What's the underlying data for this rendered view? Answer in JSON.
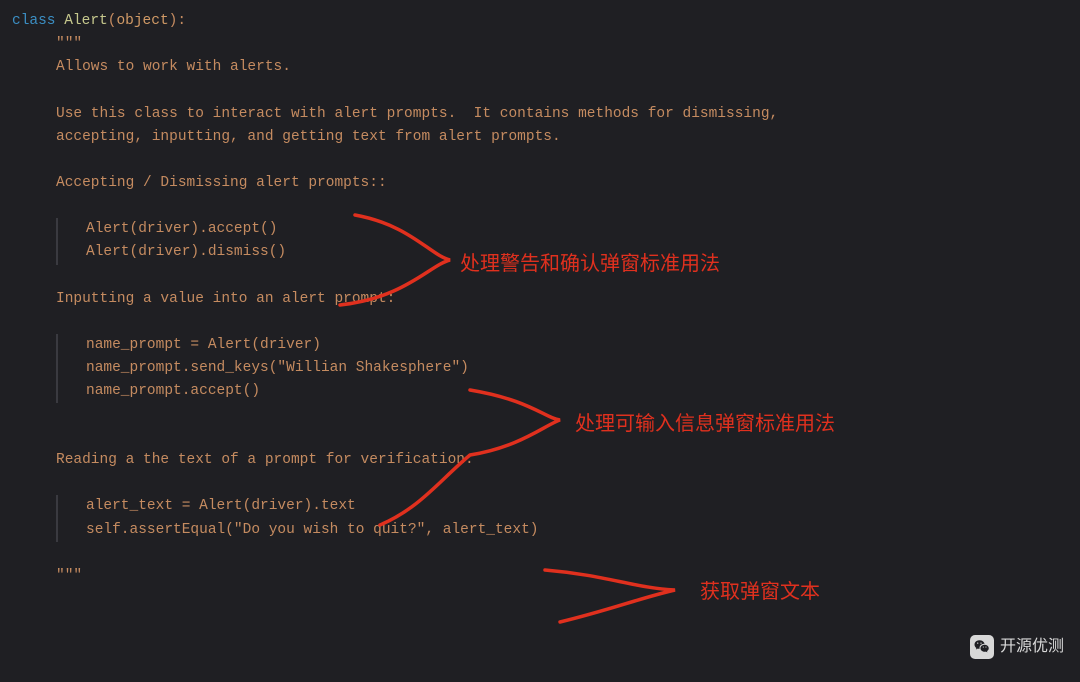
{
  "code": {
    "kw_class": "class",
    "classname": "Alert",
    "arg": "object",
    "triple_quote": "\"\"\"",
    "doc1": "Allows to work with alerts.",
    "doc2": "Use this class to interact with alert prompts.  It contains methods for dismissing,",
    "doc3": "accepting, inputting, and getting text from alert prompts.",
    "sec1_title": "Accepting / Dismissing alert prompts::",
    "sec1_line1": "Alert(driver).accept()",
    "sec1_line2": "Alert(driver).dismiss()",
    "sec2_title": "Inputting a value into an alert prompt:",
    "sec2_line1": "name_prompt = Alert(driver)",
    "sec2_line2": "name_prompt.send_keys(\"Willian Shakesphere\")",
    "sec2_line3": "name_prompt.accept()",
    "sec3_title": "Reading a the text of a prompt for verification:",
    "sec3_line1": "alert_text = Alert(driver).text",
    "sec3_line2": "self.assertEqual(\"Do you wish to quit?\", alert_text)"
  },
  "annotations": {
    "a1": "处理警告和确认弹窗标准用法",
    "a2": "处理可输入信息弹窗标准用法",
    "a3": "获取弹窗文本"
  },
  "watermark": {
    "text": "开源优测"
  }
}
